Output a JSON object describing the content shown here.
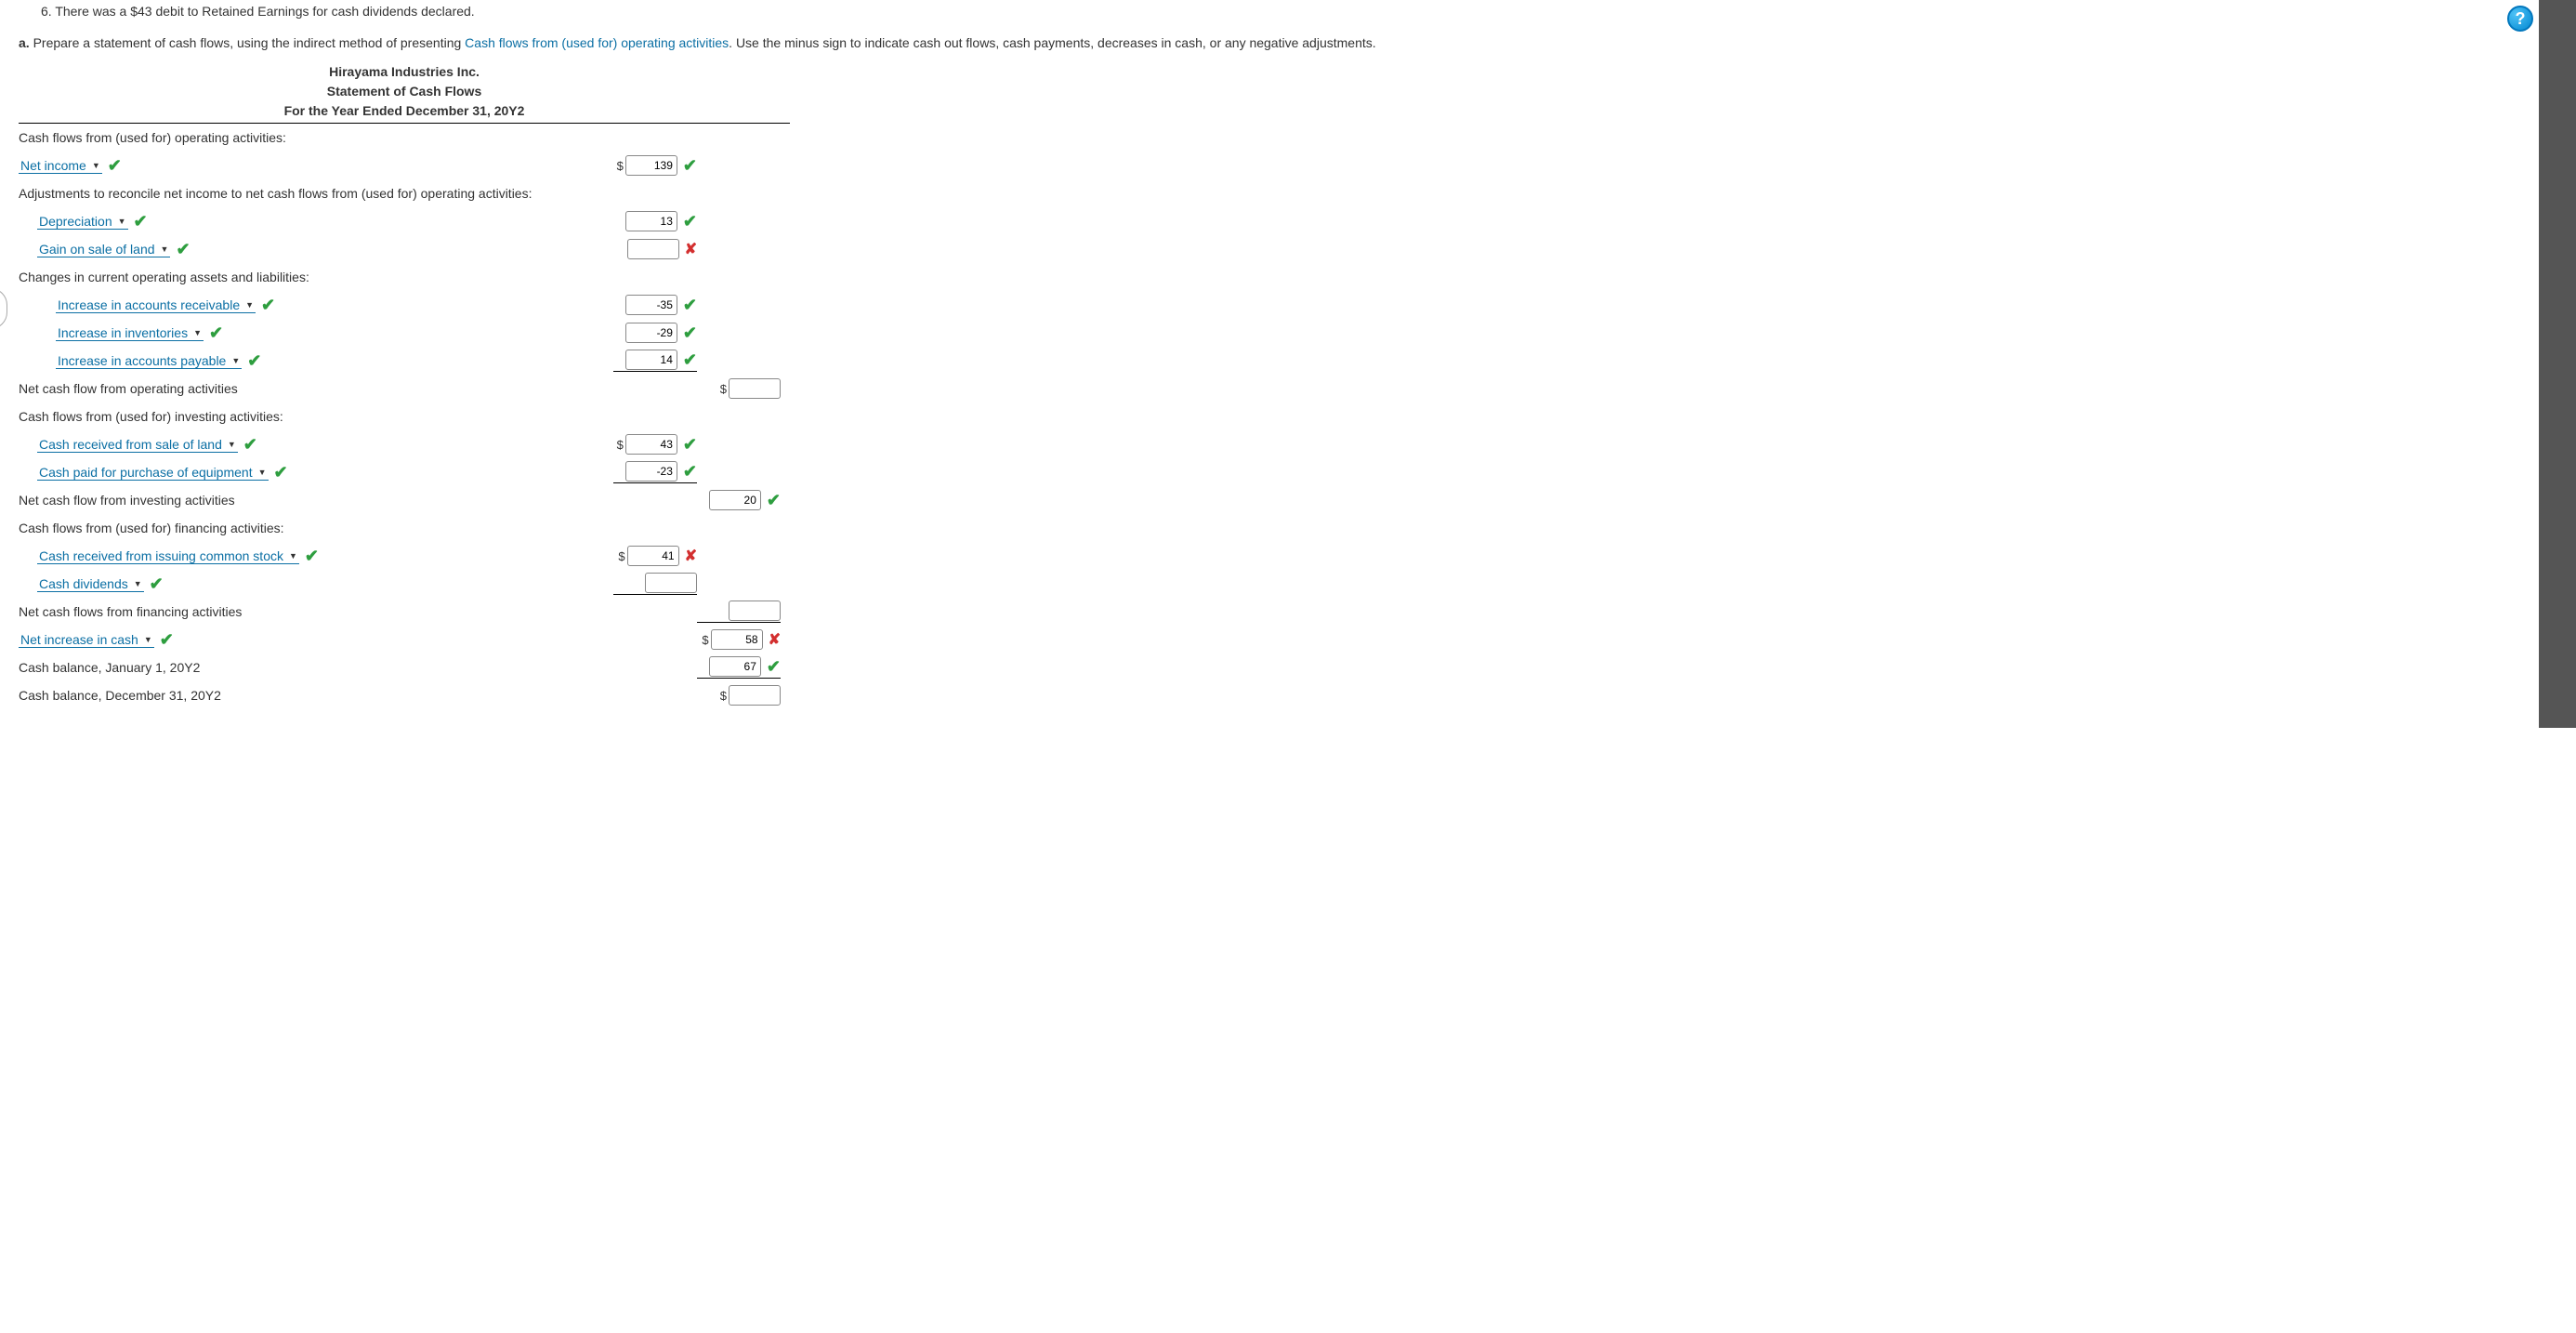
{
  "item_line": "6. There was a $43 debit to Retained Earnings for cash dividends declared.",
  "instr_a_label": "a.",
  "instr_a_pre": "Prepare a statement of cash flows, using the indirect method of presenting ",
  "instr_a_link": "Cash flows from (used for) operating activities",
  "instr_a_post": ". Use the minus sign to indicate cash out flows, cash payments, decreases in cash, or any negative adjustments.",
  "header": {
    "l1": "Hirayama Industries Inc.",
    "l2": "Statement of Cash Flows",
    "l3": "For the Year Ended December 31, 20Y2"
  },
  "lines": {
    "op_head": "Cash flows from (used for) operating activities:",
    "net_income": "Net income",
    "net_income_val": "139",
    "adjust_head": "Adjustments to reconcile net income to net cash flows from (used for) operating activities:",
    "depreciation": "Depreciation",
    "depreciation_val": "13",
    "gain_sale_land": "Gain on sale of land",
    "gain_sale_land_val": "",
    "changes_head": "Changes in current operating assets and liabilities:",
    "inc_ar": "Increase in accounts receivable",
    "inc_ar_val": "-35",
    "inc_inv": "Increase in inventories",
    "inc_inv_val": "-29",
    "inc_ap": "Increase in accounts payable",
    "inc_ap_val": "14",
    "net_op": "Net cash flow from operating activities",
    "net_op_val": "",
    "inv_head": "Cash flows from (used for) investing activities:",
    "cash_sale_land": "Cash received from sale of land",
    "cash_sale_land_val": "43",
    "cash_paid_equip": "Cash paid for purchase of equipment",
    "cash_paid_equip_val": "-23",
    "net_inv": "Net cash flow from investing activities",
    "net_inv_val": "20",
    "fin_head": "Cash flows from (used for) financing activities:",
    "cash_stock": "Cash received from issuing common stock",
    "cash_stock_val": "41",
    "cash_div": "Cash dividends",
    "cash_div_val": "",
    "net_fin": "Net cash flows from financing activities",
    "net_fin_val": "",
    "net_inc_cash": "Net increase in cash",
    "net_inc_cash_val": "58",
    "bal_jan": "Cash balance, January 1, 20Y2",
    "bal_jan_val": "67",
    "bal_dec": "Cash balance, December 31, 20Y2",
    "bal_dec_val": ""
  },
  "help_glyph": "?"
}
